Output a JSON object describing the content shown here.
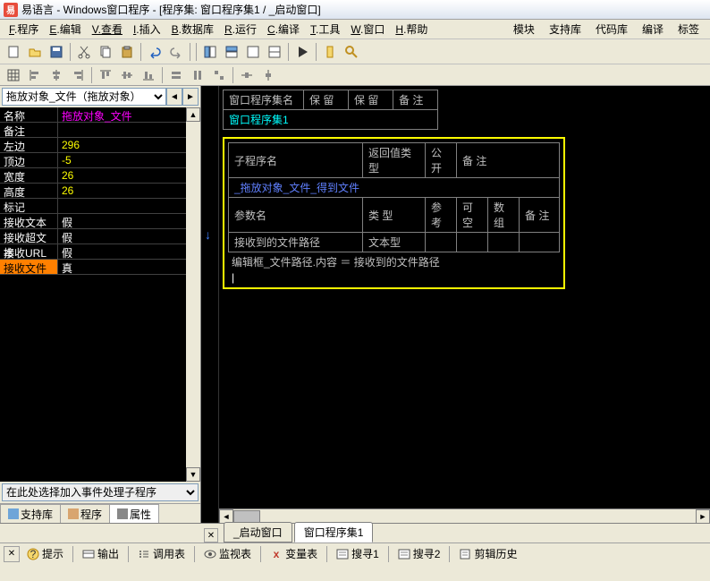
{
  "title": "易语言 - Windows窗口程序 - [程序集: 窗口程序集1 / _启动窗口]",
  "menu": {
    "file": "F.程序",
    "edit": "E.编辑",
    "view": "V.查看",
    "insert": "I.插入",
    "database": "B.数据库",
    "run": "R.运行",
    "compile": "C.编译",
    "tools": "T.工具",
    "window": "W.窗口",
    "help": "H.帮助",
    "module": "模块",
    "support": "支持库",
    "codebank": "代码库",
    "compile2": "编译",
    "tags": "标签"
  },
  "object_selector": "拖放对象_文件（拖放对象）",
  "props": [
    {
      "name": "名称",
      "value": "拖放对象_文件",
      "cls": "magenta"
    },
    {
      "name": "备注",
      "value": "",
      "cls": "white"
    },
    {
      "name": "左边",
      "value": "296",
      "cls": "yellow"
    },
    {
      "name": "顶边",
      "value": "-5",
      "cls": "yellow"
    },
    {
      "name": "宽度",
      "value": "26",
      "cls": "yellow"
    },
    {
      "name": "高度",
      "value": "26",
      "cls": "yellow"
    },
    {
      "name": "标记",
      "value": "",
      "cls": "white"
    },
    {
      "name": "接收文本",
      "value": "假",
      "cls": "white"
    },
    {
      "name": "接收超文本",
      "value": "假",
      "cls": "white"
    },
    {
      "name": "接收URL",
      "value": "假",
      "cls": "white"
    },
    {
      "name": "接收文件",
      "value": "真",
      "cls": "white",
      "selected": true
    }
  ],
  "event_selector": "在此处选择加入事件处理子程序",
  "left_tabs": {
    "support": "支持库",
    "program": "程序",
    "property": "属性"
  },
  "table1": {
    "h1": "窗口程序集名",
    "h2": "保 留",
    "h3": "保 留",
    "h4": "备 注",
    "v1": "窗口程序集1"
  },
  "table2": {
    "r1c1": "子程序名",
    "r1c2": "返回值类型",
    "r1c3": "公开",
    "r1c4": "备 注",
    "r2c1": "_拖放对象_文件_得到文件",
    "r3c1": "参数名",
    "r3c2": "类 型",
    "r3c3": "参考",
    "r3c4": "可空",
    "r3c5": "数组",
    "r3c6": "备 注",
    "r4c1": "接收到的文件路径",
    "r4c2": "文本型"
  },
  "code": {
    "line1_a": "编辑框_文件路径.内容",
    "line1_eq": " ＝ ",
    "line1_b": "接收到的文件路径"
  },
  "bottom_tabs": {
    "t1": "_启动窗口",
    "t2": "窗口程序集1"
  },
  "status": {
    "hint": "提示",
    "output": "输出",
    "callstack": "调用表",
    "watch": "监视表",
    "vars": "变量表",
    "search1": "搜寻1",
    "search2": "搜寻2",
    "clip": "剪辑历史"
  }
}
